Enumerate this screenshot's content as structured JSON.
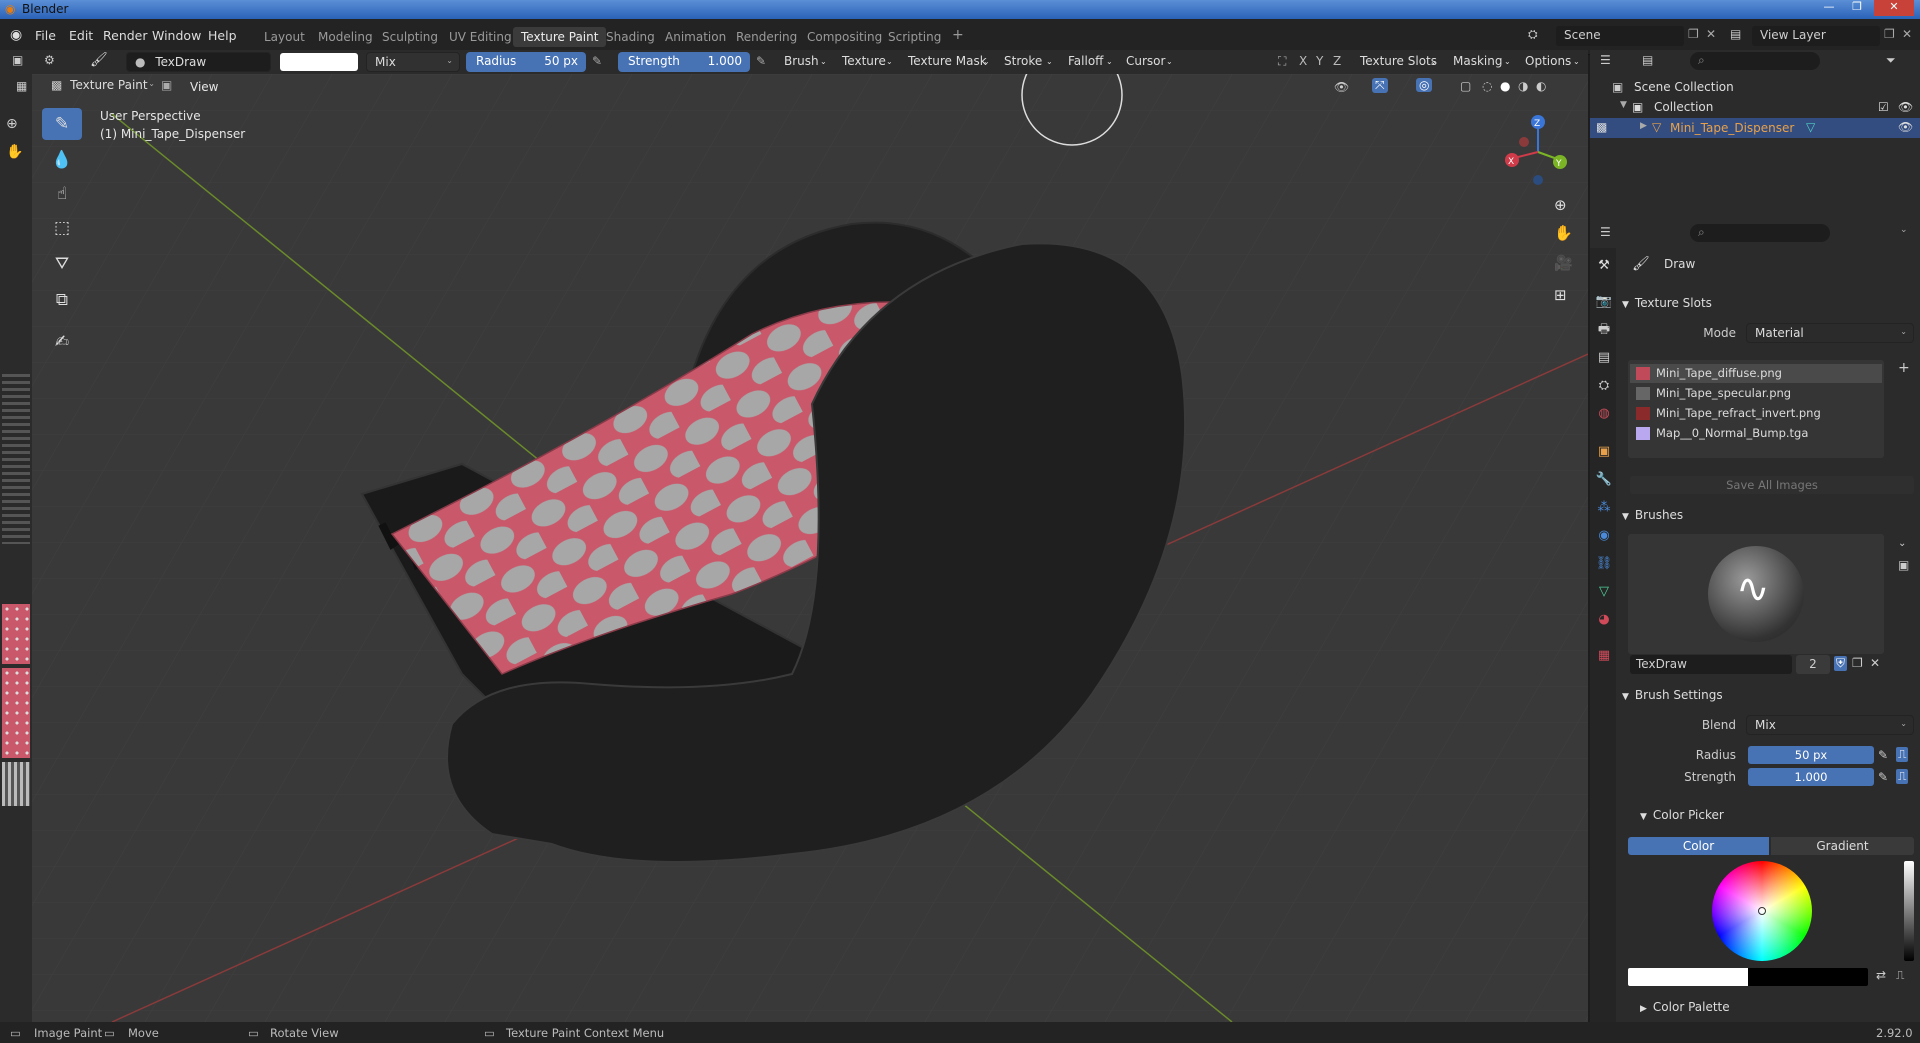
{
  "window": {
    "title": "Blender",
    "controls": [
      "—",
      "❐",
      "✕"
    ]
  },
  "menu": {
    "items": [
      "File",
      "Edit",
      "Render",
      "Window",
      "Help"
    ]
  },
  "workspaces": [
    {
      "label": "Layout",
      "active": false
    },
    {
      "label": "Modeling",
      "active": false
    },
    {
      "label": "Sculpting",
      "active": false
    },
    {
      "label": "UV Editing",
      "active": false
    },
    {
      "label": "Texture Paint",
      "active": true
    },
    {
      "label": "Shading",
      "active": false
    },
    {
      "label": "Animation",
      "active": false
    },
    {
      "label": "Rendering",
      "active": false
    },
    {
      "label": "Compositing",
      "active": false
    },
    {
      "label": "Scripting",
      "active": false
    }
  ],
  "add_workspace": "+",
  "scene": {
    "name": "Scene",
    "view_layer": "View Layer"
  },
  "tool_header": {
    "brush_name": "TexDraw",
    "blend": "Mix",
    "radius_label": "Radius",
    "radius_value": "50 px",
    "strength_label": "Strength",
    "strength_value": "1.000",
    "menus": [
      "Brush",
      "Texture",
      "Texture Mask",
      "Stroke",
      "Falloff",
      "Cursor"
    ],
    "axes": [
      "X",
      "Y",
      "Z"
    ],
    "right_menus": [
      "Texture Slots",
      "Masking",
      "Options"
    ]
  },
  "viewport_header": {
    "mode": "Texture Paint",
    "view": "View"
  },
  "viewport": {
    "perspective": "User Perspective",
    "object": "(1) Mini_Tape_Dispenser",
    "gizmo_axes": {
      "x": "X",
      "y": "Y",
      "z": "Z"
    }
  },
  "outliner": {
    "scene_collection": "Scene Collection",
    "collection": "Collection",
    "object": "Mini_Tape_Dispenser"
  },
  "properties": {
    "tool_name": "Draw",
    "texture_slots": {
      "title": "Texture Slots",
      "mode_label": "Mode",
      "mode_value": "Material",
      "slots": [
        {
          "name": "Mini_Tape_diffuse.png",
          "selected": true,
          "color": "#c04a5a"
        },
        {
          "name": "Mini_Tape_specular.png",
          "selected": false,
          "color": "#666666"
        },
        {
          "name": "Mini_Tape_refract_invert.png",
          "selected": false,
          "color": "#8a2a2a"
        },
        {
          "name": "Map__0_Normal_Bump.tga",
          "selected": false,
          "color": "#b9a8f0"
        }
      ],
      "save_all": "Save All Images"
    },
    "brushes": {
      "title": "Brushes",
      "name": "TexDraw",
      "users": "2"
    },
    "brush_settings": {
      "title": "Brush Settings",
      "blend_label": "Blend",
      "blend_value": "Mix",
      "radius_label": "Radius",
      "radius_value": "50 px",
      "strength_label": "Strength",
      "strength_value": "1.000"
    },
    "color_picker": {
      "title": "Color Picker",
      "tab_color": "Color",
      "tab_gradient": "Gradient"
    },
    "color_palette": {
      "title": "Color Palette"
    }
  },
  "statusbar": {
    "image_paint": "Image Paint",
    "move": "Move",
    "rotate": "Rotate View",
    "context": "Texture Paint Context Menu",
    "version": "2.92.0"
  },
  "colors": {
    "accent": "#4772b3",
    "tape": "#c9586a",
    "dots": "#a7a7a7",
    "body": "#1f1f1f"
  }
}
